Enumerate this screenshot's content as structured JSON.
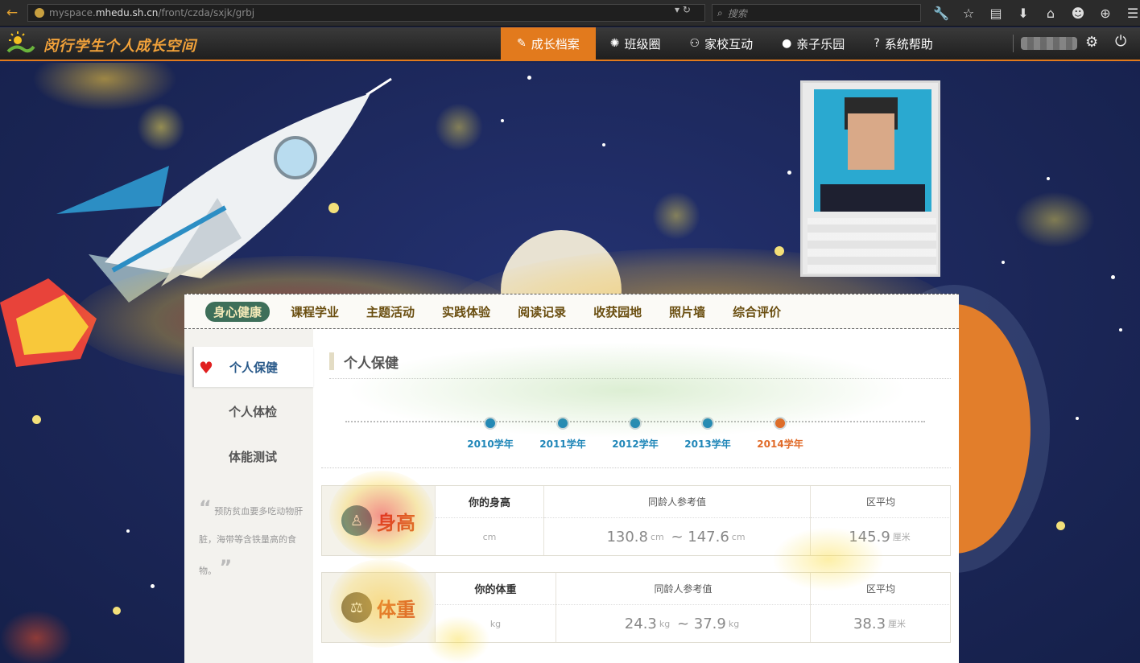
{
  "browser": {
    "url_prefix": "myspace.",
    "url_host": "mhedu.sh.cn",
    "url_path": "/front/czda/sxjk/grbj",
    "search_placeholder": "搜索"
  },
  "header": {
    "app_title": "闵行学生个人成长空间",
    "nav": [
      {
        "label": "成长档案",
        "icon": "book-icon",
        "active": true
      },
      {
        "label": "班级圈",
        "icon": "aperture-icon",
        "active": false
      },
      {
        "label": "家校互动",
        "icon": "people-icon",
        "active": false
      },
      {
        "label": "亲子乐园",
        "icon": "mickey-icon",
        "active": false
      },
      {
        "label": "系统帮助",
        "icon": "question-icon",
        "active": false
      }
    ]
  },
  "subnav": [
    "身心健康",
    "课程学业",
    "主题活动",
    "实践体验",
    "阅读记录",
    "收获园地",
    "照片墙",
    "综合评价"
  ],
  "sidebar": {
    "items": [
      "个人保健",
      "个人体检",
      "体能测试"
    ],
    "tip": "预防贫血要多吃动物肝脏，海带等含铁量高的食物。"
  },
  "section": {
    "title": "个人保健"
  },
  "timeline": {
    "years": [
      {
        "label": "2010学年",
        "color": "#1f86b8"
      },
      {
        "label": "2011学年",
        "color": "#1f86b8"
      },
      {
        "label": "2012学年",
        "color": "#1f86b8"
      },
      {
        "label": "2013学年",
        "color": "#1f86b8"
      },
      {
        "label": "2014学年",
        "color": "#e06a28"
      }
    ]
  },
  "metrics": {
    "height": {
      "name": "身高",
      "your_label": "你的身高",
      "your_unit": "cm",
      "ref_label": "同龄人参考值",
      "ref_low": "130.8",
      "ref_high": "147.6",
      "ref_unit": "cm",
      "avg_label": "区平均",
      "avg_value": "145.9",
      "avg_unit": "厘米"
    },
    "weight": {
      "name": "体重",
      "your_label": "你的体重",
      "your_unit": "kg",
      "ref_label": "同龄人参考值",
      "ref_low": "24.3",
      "ref_high": "37.9",
      "ref_unit": "kg",
      "avg_label": "区平均",
      "avg_value": "38.3",
      "avg_unit": "厘米"
    }
  },
  "colors": {
    "accent": "#e27a1d",
    "nav_active_bg": "#e27a1d",
    "subnav_active_bg": "#3e6f5a",
    "metric_name": "#d23c1c",
    "timeline_past": "#1f86b8",
    "timeline_current": "#e06a28"
  }
}
